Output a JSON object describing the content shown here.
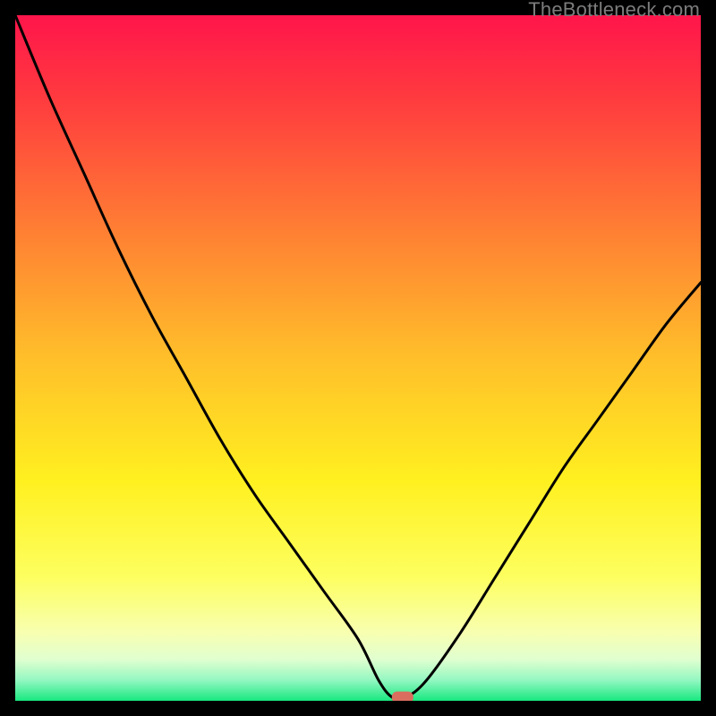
{
  "watermark": "TheBottleneck.com",
  "chart_data": {
    "type": "line",
    "title": "",
    "xlabel": "",
    "ylabel": "",
    "xlim": [
      0,
      100
    ],
    "ylim": [
      0,
      100
    ],
    "grid": false,
    "series": [
      {
        "name": "curve",
        "x": [
          0,
          5,
          10,
          15,
          20,
          25,
          30,
          35,
          40,
          45,
          50,
          53,
          55,
          57,
          60,
          65,
          70,
          75,
          80,
          85,
          90,
          95,
          100
        ],
        "y": [
          100,
          88,
          77,
          66,
          56,
          47,
          38,
          30,
          23,
          16,
          9,
          3,
          0.5,
          0.5,
          3,
          10,
          18,
          26,
          34,
          41,
          48,
          55,
          61
        ]
      }
    ],
    "marker": {
      "x": 56.5,
      "y": 0.5
    },
    "gradient_stops": [
      {
        "offset": 0.0,
        "color": "#ff154b"
      },
      {
        "offset": 0.12,
        "color": "#ff3a3f"
      },
      {
        "offset": 0.3,
        "color": "#ff7a34"
      },
      {
        "offset": 0.5,
        "color": "#ffbf2a"
      },
      {
        "offset": 0.68,
        "color": "#fff020"
      },
      {
        "offset": 0.82,
        "color": "#fdff60"
      },
      {
        "offset": 0.9,
        "color": "#f8ffb0"
      },
      {
        "offset": 0.94,
        "color": "#e0ffd0"
      },
      {
        "offset": 0.97,
        "color": "#93f7c1"
      },
      {
        "offset": 1.0,
        "color": "#18e880"
      }
    ],
    "marker_color": "#d96e5e",
    "line_color": "#000000"
  }
}
